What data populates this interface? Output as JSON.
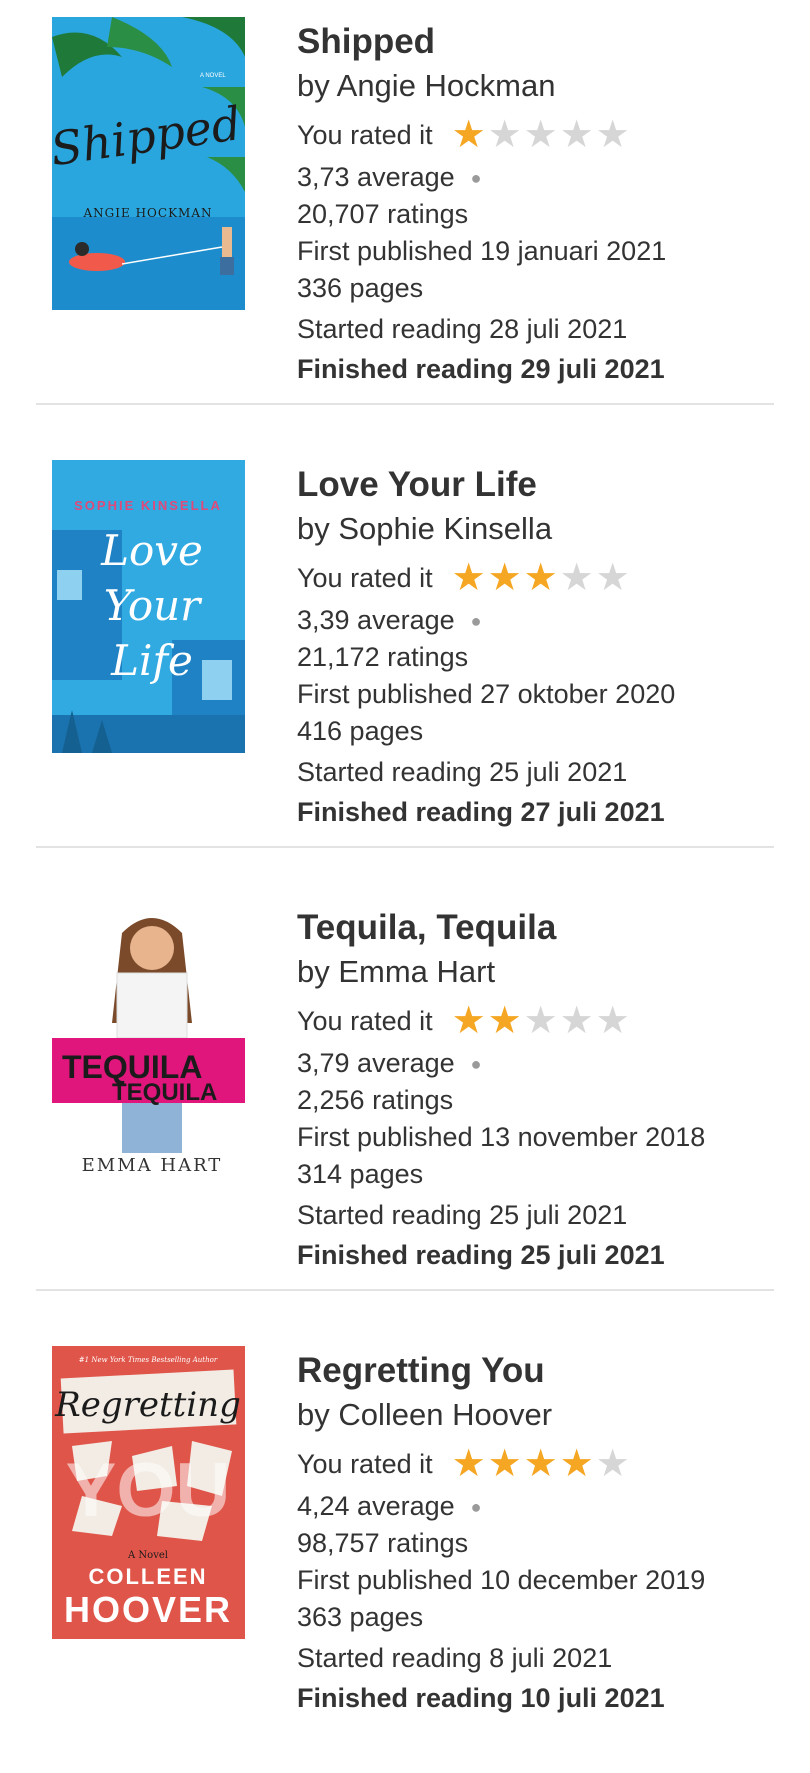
{
  "books": [
    {
      "title": "Shipped",
      "author": "by Angie Hockman",
      "rated_label": "You rated it",
      "rating": 1,
      "average": "3,73 average",
      "ratings": "20,707 ratings",
      "published": "First published 19 januari 2021",
      "pages": "336 pages",
      "started": "Started reading 28 juli 2021",
      "finished": "Finished reading 29 juli 2021",
      "cover": {
        "small": "A NOVEL",
        "script_title": "Shipped",
        "author": "ANGIE HOCKMAN",
        "colors": [
          "#29a9e0",
          "#1b8fd0"
        ]
      }
    },
    {
      "title": "Love Your Life",
      "author": "by Sophie Kinsella",
      "rated_label": "You rated it",
      "rating": 3,
      "average": "3,39 average",
      "ratings": "21,172 ratings",
      "published": "First published 27 oktober 2020",
      "pages": "416 pages",
      "started": "Started reading 25 juli 2021",
      "finished": "Finished reading 27 juli 2021",
      "cover": {
        "author": "SOPHIE KINSELLA",
        "script_1": "Love",
        "script_2": "Your",
        "script_3": "Life",
        "colors": [
          "#2fa8e0",
          "#1e88c8"
        ]
      }
    },
    {
      "title": "Tequila, Tequila",
      "author": "by Emma Hart",
      "rated_label": "You rated it",
      "rating": 2,
      "average": "3,79 average",
      "ratings": "2,256 ratings",
      "published": "First published 13 november 2018",
      "pages": "314 pages",
      "started": "Started reading 25 juli 2021",
      "finished": "Finished reading 25 juli 2021",
      "cover": {
        "line_1": "TEQUILA",
        "line_2": "TEQUILA",
        "author": "EMMA HART",
        "colors": [
          "#ffffff",
          "#e0167d"
        ]
      }
    },
    {
      "title": "Regretting You",
      "author": "by Colleen Hoover",
      "rated_label": "You rated it",
      "rating": 4,
      "average": "4,24 average",
      "ratings": "98,757 ratings",
      "published": "First published 10 december 2019",
      "pages": "363 pages",
      "started": "Started reading 8 juli 2021",
      "finished": "Finished reading 10 juli 2021",
      "cover": {
        "tagline": "#1 New York Times Bestselling Author",
        "script_title": "Regretting",
        "big": "YOU",
        "novel": "A Novel",
        "author_1": "COLLEEN",
        "author_2": "HOOVER",
        "colors": [
          "#e0554a",
          "#c9423a"
        ]
      }
    }
  ],
  "star_on_color": "#f5a623",
  "star_off_color": "#d6d6d6",
  "icons": {
    "star": "star-icon",
    "dot": "bullet-dot-icon"
  }
}
